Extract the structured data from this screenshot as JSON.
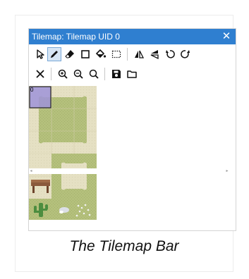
{
  "window": {
    "title": "Tilemap: Tilemap UID 0",
    "close_glyph": "✕"
  },
  "toolbar": {
    "row1": [
      {
        "name": "select-arrow-icon",
        "state": "normal"
      },
      {
        "name": "pencil-icon",
        "state": "active"
      },
      {
        "name": "eraser-icon",
        "state": "normal"
      },
      {
        "name": "rectangle-icon",
        "state": "normal"
      },
      {
        "name": "paint-bucket-icon",
        "state": "normal"
      },
      {
        "name": "dashed-selection-icon",
        "state": "normal"
      },
      {
        "name": "flip-horizontal-icon",
        "state": "normal"
      },
      {
        "name": "flip-vertical-icon",
        "state": "normal"
      },
      {
        "name": "rotate-left-icon",
        "state": "normal"
      },
      {
        "name": "rotate-right-icon",
        "state": "normal"
      }
    ],
    "row2": [
      {
        "name": "clear-icon"
      },
      {
        "name": "zoom-in-icon"
      },
      {
        "name": "zoom-out-icon"
      },
      {
        "name": "zoom-reset-icon"
      },
      {
        "name": "save-icon"
      },
      {
        "name": "open-folder-icon"
      }
    ]
  },
  "tileset": {
    "selected_tile_index": "0",
    "colors": {
      "sand": "#e4dfc1",
      "grass": "#b3bf7a",
      "grass_dark": "#9eab67",
      "selection": "#9f93d9",
      "cactus": "#4c8d3f",
      "table": "#8a5a3c"
    }
  },
  "caption": "The Tilemap Bar",
  "colors": {
    "titlebar": "#2f7fd0",
    "active_tool_bg": "#d7e6f5"
  }
}
